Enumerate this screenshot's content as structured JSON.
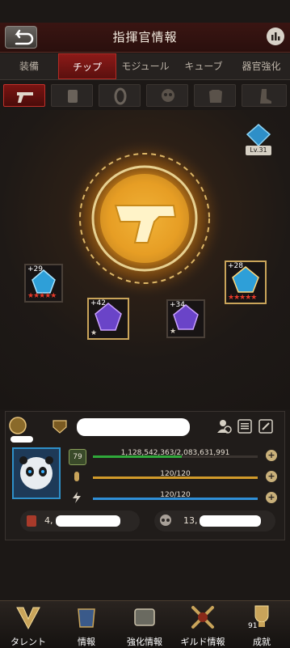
{
  "header": {
    "title": "指揮官情報"
  },
  "tabs": [
    {
      "label": "装備",
      "active": false
    },
    {
      "label": "チップ",
      "active": true
    },
    {
      "label": "モジュール",
      "active": false
    },
    {
      "label": "キューブ",
      "active": false
    },
    {
      "label": "器官強化",
      "active": false
    }
  ],
  "subtabs": [
    "pistol-icon",
    "vest-icon",
    "ring-icon",
    "mask-icon",
    "armor-icon",
    "boots-icon"
  ],
  "main": {
    "level_badge": "Lv.31",
    "chips": [
      {
        "value": "+29",
        "stars": "★★★★★"
      },
      {
        "value": "+28",
        "stars": "★★★★★"
      },
      {
        "value": "+42",
        "stars": "★"
      },
      {
        "value": "+34",
        "stars": "★"
      }
    ]
  },
  "panel": {
    "avatar_level": "79",
    "stats": [
      {
        "text": "1,128,542,363/2,083,631,991",
        "fill": 0.54,
        "color": "#2fa83a"
      },
      {
        "text": "120/120",
        "fill": 1.0,
        "color": "#d19a2a"
      },
      {
        "text": "120/120",
        "fill": 1.0,
        "color": "#2f8fd8"
      }
    ],
    "resource_left": "4,",
    "resource_right": "13,"
  },
  "bottomnav": [
    {
      "label": "タレント"
    },
    {
      "label": "情報"
    },
    {
      "label": "強化情報"
    },
    {
      "label": "ギルド情報"
    },
    {
      "label": "成就",
      "count": "91"
    }
  ],
  "colors": {
    "accent": "#b32a24",
    "gold": "#e6a92a"
  }
}
